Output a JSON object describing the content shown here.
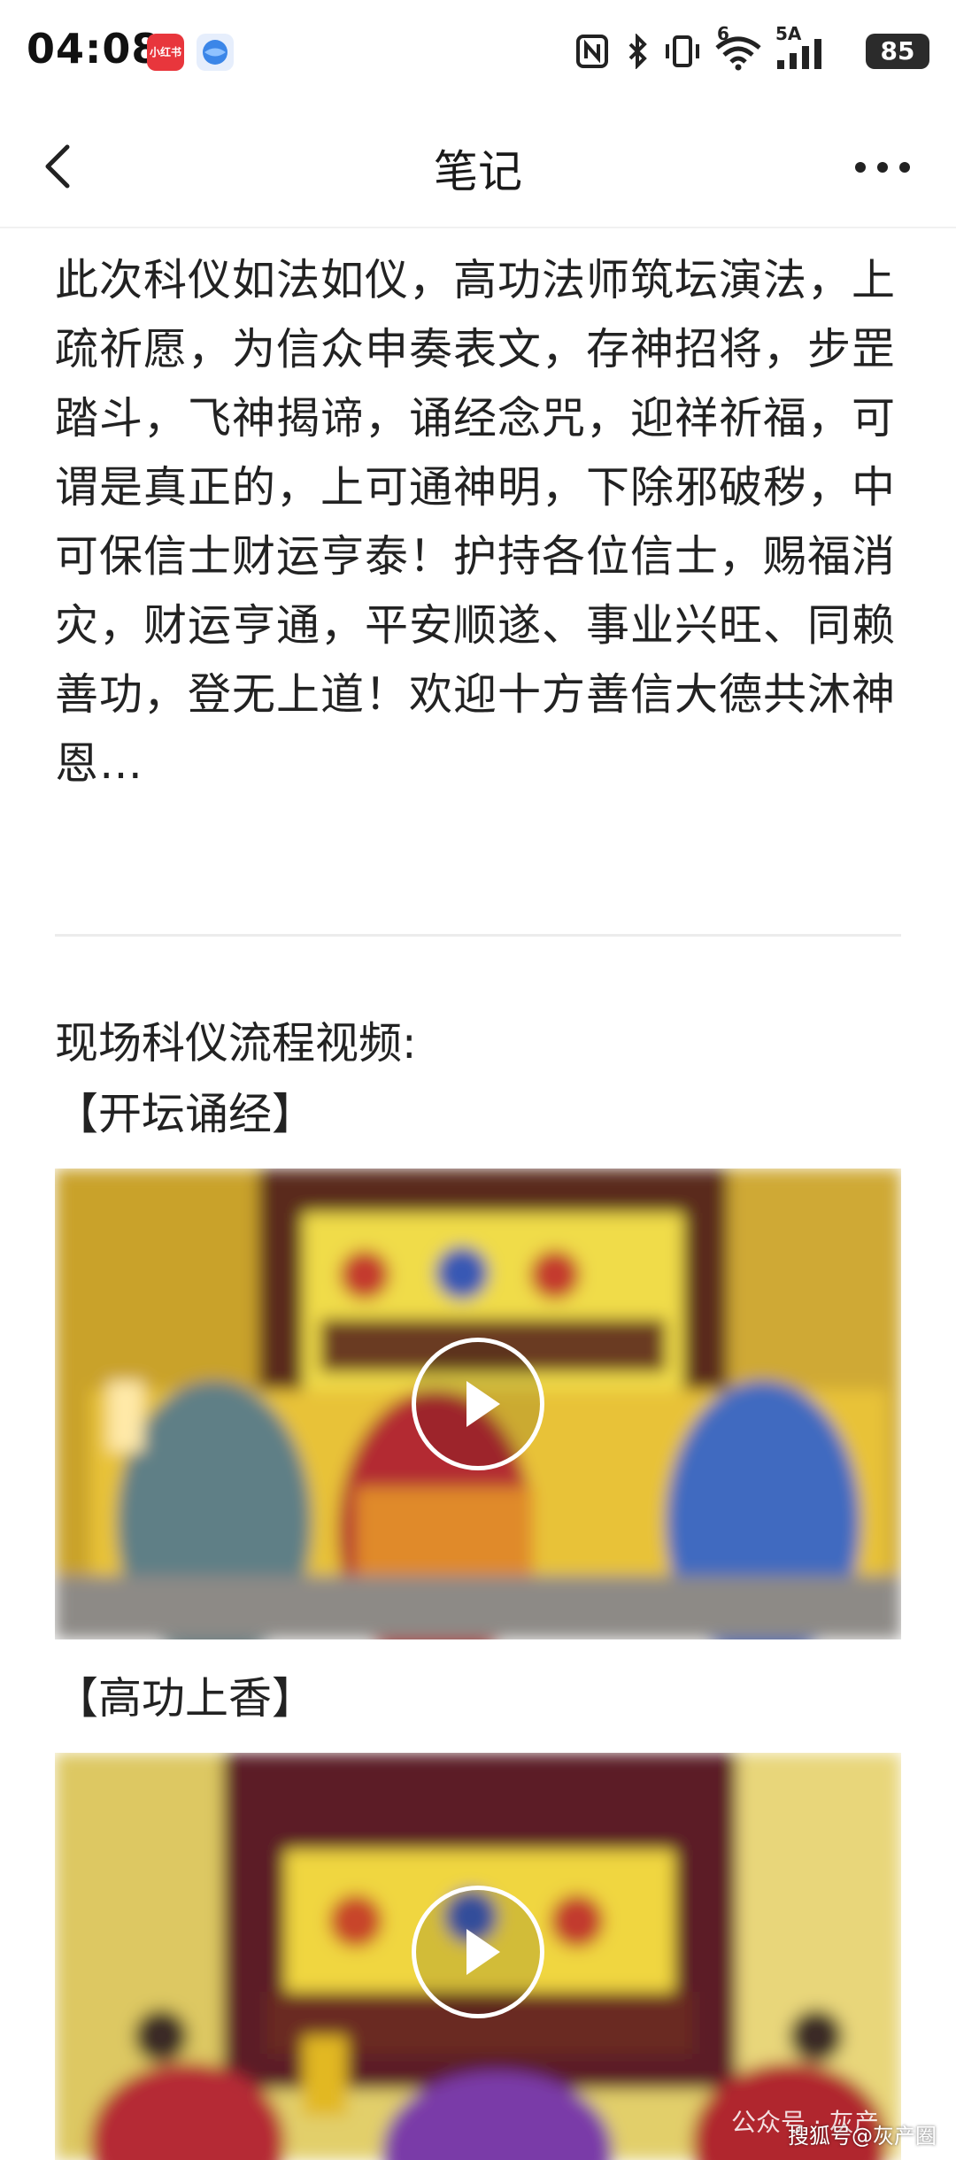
{
  "status_bar": {
    "time": "04:08",
    "app_badge_text": "小红书",
    "network_label_top": "6",
    "network_label_5a": "5A",
    "battery": "85"
  },
  "nav": {
    "title": "笔记"
  },
  "article": {
    "paragraph": "此次科仪如法如仪，高功法师筑坛演法，上疏祈愿，为信众申奏表文，存神招将，步罡踏斗，飞神揭谛，诵经念咒，迎祥祈福，可谓是真正的，上可通神明，下除邪破秽，中可保信士财运亨泰！护持各位信士，赐福消灾，财运亨通，平安顺遂、事业兴旺、同赖善功，登无上道！欢迎十方善信大德共沐神恩…",
    "section_intro": "现场科仪流程视频:",
    "videos": [
      {
        "caption": "【开坛诵经】"
      },
      {
        "caption": "【高功上香】"
      }
    ]
  },
  "watermark": "公众号 · 灰产",
  "footer_source": "搜狐号@灰产圈",
  "colors": {
    "accent_red": "#e8363c",
    "temple_yellow": "#e9c52a",
    "robe_blue": "#3a63b8",
    "robe_red": "#b8262c"
  }
}
